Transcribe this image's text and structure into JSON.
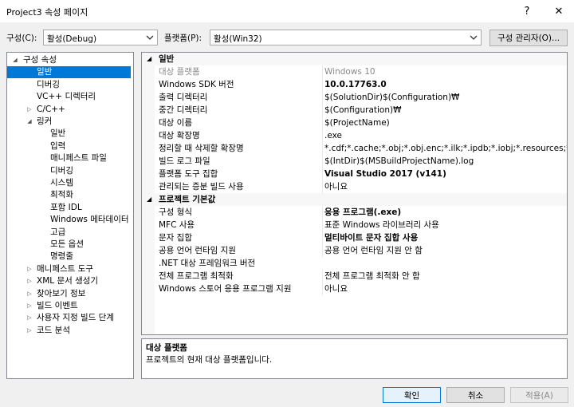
{
  "window": {
    "title": "Project3 속성 페이지",
    "help_label": "?",
    "close_label": "✕"
  },
  "config": {
    "configuration_label": "구성(C):",
    "configuration_value": "활성(Debug)",
    "platform_label": "플랫폼(P):",
    "platform_value": "활성(Win32)",
    "manager_button": "구성 관리자(O)..."
  },
  "tree": {
    "items": [
      {
        "label": "구성 속성",
        "arrow": "◢"
      },
      {
        "label": "일반"
      },
      {
        "label": "디버깅"
      },
      {
        "label": "VC++ 디렉터리"
      },
      {
        "label": "C/C++",
        "arrow": "▷"
      },
      {
        "label": "링커",
        "arrow": "◢"
      },
      {
        "label": "일반"
      },
      {
        "label": "입력"
      },
      {
        "label": "매니페스트 파일"
      },
      {
        "label": "디버깅"
      },
      {
        "label": "시스템"
      },
      {
        "label": "최적화"
      },
      {
        "label": "포함 IDL"
      },
      {
        "label": "Windows 메타데이터"
      },
      {
        "label": "고급"
      },
      {
        "label": "모든 옵션"
      },
      {
        "label": "명령줄"
      },
      {
        "label": "매니페스트 도구",
        "arrow": "▷"
      },
      {
        "label": "XML 문서 생성기",
        "arrow": "▷"
      },
      {
        "label": "찾아보기 정보",
        "arrow": "▷"
      },
      {
        "label": "빌드 이벤트",
        "arrow": "▷"
      },
      {
        "label": "사용자 지정 빌드 단계",
        "arrow": "▷"
      },
      {
        "label": "코드 분석",
        "arrow": "▷"
      }
    ]
  },
  "grid": {
    "category_general": "일반",
    "category_defaults": "프로젝트 기본값",
    "general_rows": [
      {
        "name": "대상 플랫폼",
        "value": "Windows 10"
      },
      {
        "name": "Windows SDK 버전",
        "value": "10.0.17763.0"
      },
      {
        "name": "출력 디렉터리",
        "value": "$(SolutionDir)$(Configuration)₩"
      },
      {
        "name": "중간 디렉터리",
        "value": "$(Configuration)₩"
      },
      {
        "name": "대상 이름",
        "value": "$(ProjectName)"
      },
      {
        "name": "대상 확장명",
        "value": ".exe"
      },
      {
        "name": "정리할 때 삭제할 확장명",
        "value": "*.cdf;*.cache;*.obj;*.obj.enc;*.ilk;*.ipdb;*.iobj;*.resources;*.tlb;*.tli;*.tl"
      },
      {
        "name": "빌드 로그 파일",
        "value": "$(IntDir)$(MSBuildProjectName).log"
      },
      {
        "name": "플랫폼 도구 집합",
        "value": "Visual Studio 2017 (v141)"
      },
      {
        "name": "관리되는 증분 빌드 사용",
        "value": "아니요"
      }
    ],
    "defaults_rows": [
      {
        "name": "구성 형식",
        "value": "응용 프로그램(.exe)"
      },
      {
        "name": "MFC 사용",
        "value": "표준 Windows 라이브러리 사용"
      },
      {
        "name": "문자 집합",
        "value": "멀티바이트 문자 집합 사용"
      },
      {
        "name": "공용 언어 런타임 지원",
        "value": "공용 언어 런타임 지원 안 함"
      },
      {
        "name": ".NET 대상 프레임워크 버전",
        "value": ""
      },
      {
        "name": "전체 프로그램 최적화",
        "value": "전체 프로그램 최적화 안 함"
      },
      {
        "name": "Windows 스토어 응용 프로그램 지원",
        "value": "아니요"
      }
    ]
  },
  "description": {
    "title": "대상 플랫폼",
    "text": "프로젝트의 현재 대상 플랫폼입니다."
  },
  "buttons": {
    "ok": "확인",
    "cancel": "취소",
    "apply": "적용(A)"
  }
}
